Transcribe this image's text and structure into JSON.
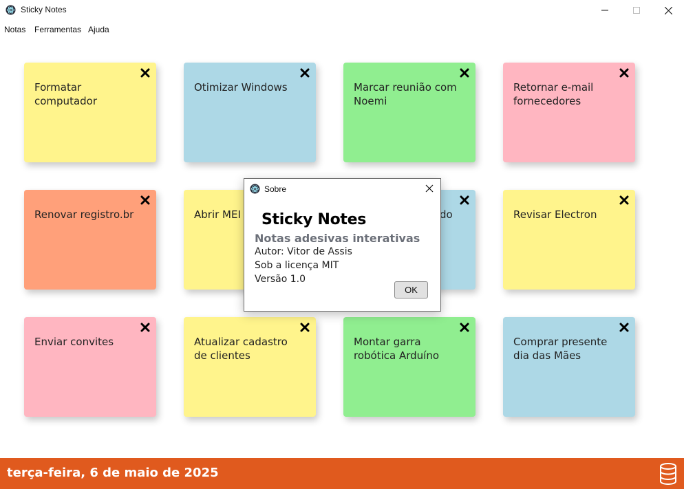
{
  "window": {
    "title": "Sticky Notes",
    "icon": "electron-logo-icon"
  },
  "menu": [
    "Notas",
    "Ferramentas",
    "Ajuda"
  ],
  "notes": [
    {
      "text": "Formatar computador",
      "color": "#fff48c"
    },
    {
      "text": "Otimizar Windows",
      "color": "#add8e6"
    },
    {
      "text": "Marcar reunião com Noemi",
      "color": "#90ee90"
    },
    {
      "text": "Retornar e-mail fornecedores",
      "color": "#ffb6c1"
    },
    {
      "text": "Renovar registro.br",
      "color": "#ffa07a"
    },
    {
      "text": "Abrir MEI",
      "color": "#fff48c"
    },
    {
      "text": "e do",
      "color": "#add8e6"
    },
    {
      "text": "Revisar Electron",
      "color": "#fff48c"
    },
    {
      "text": "Enviar convites",
      "color": "#ffb6c1"
    },
    {
      "text": "Atualizar cadastro de clientes",
      "color": "#fff48c"
    },
    {
      "text": "Montar garra robótica Arduíno",
      "color": "#90ee90"
    },
    {
      "text": "Comprar presente dia das Mães",
      "color": "#add8e6"
    }
  ],
  "footer": {
    "date": "terça-feira, 6 de maio de 2025",
    "color": "#e05a1e",
    "icon": "database-icon"
  },
  "about_dialog": {
    "title": "Sobre",
    "app_name": "Sticky Notes",
    "subtitle": "Notas adesivas interativas",
    "author": "Autor: Vitor de Assis",
    "license": "Sob a licença MIT",
    "version": "Versão 1.0",
    "ok_label": "OK"
  }
}
